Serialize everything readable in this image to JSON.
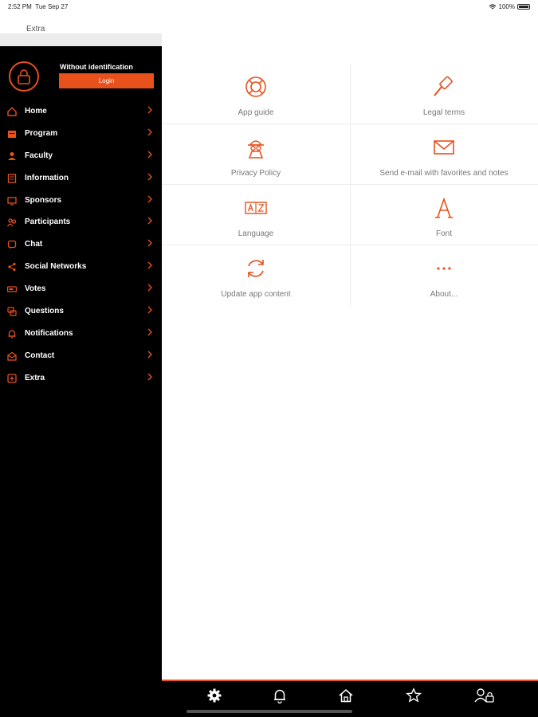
{
  "status_bar": {
    "time": "2:52 PM",
    "date": "Tue Sep 27",
    "battery": "100%"
  },
  "header": {
    "title": "Extra"
  },
  "profile": {
    "name": "Without identification",
    "login_label": "Login"
  },
  "menu": {
    "items": [
      {
        "label": "Home",
        "icon": "home-icon"
      },
      {
        "label": "Program",
        "icon": "calendar-icon"
      },
      {
        "label": "Faculty",
        "icon": "person-icon"
      },
      {
        "label": "Information",
        "icon": "info-icon"
      },
      {
        "label": "Sponsors",
        "icon": "sponsors-icon"
      },
      {
        "label": "Participants",
        "icon": "participants-icon"
      },
      {
        "label": "Chat",
        "icon": "chat-icon"
      },
      {
        "label": "Social Networks",
        "icon": "share-icon"
      },
      {
        "label": "Votes",
        "icon": "votes-icon"
      },
      {
        "label": "Questions",
        "icon": "questions-icon"
      },
      {
        "label": "Notifications",
        "icon": "bell-icon"
      },
      {
        "label": "Contact",
        "icon": "mail-icon"
      },
      {
        "label": "Extra",
        "icon": "plus-icon"
      }
    ]
  },
  "grid": {
    "items": [
      {
        "label": "App guide",
        "icon": "lifebuoy-icon"
      },
      {
        "label": "Legal terms",
        "icon": "gavel-icon"
      },
      {
        "label": "Privacy Policy",
        "icon": "privacy-icon"
      },
      {
        "label": "Send e-mail with favorites and notes",
        "icon": "envelope-icon"
      },
      {
        "label": "Language",
        "icon": "language-icon"
      },
      {
        "label": "Font",
        "icon": "font-icon"
      },
      {
        "label": "Update app content",
        "icon": "refresh-icon"
      },
      {
        "label": "About...",
        "icon": "ellipsis-icon"
      }
    ]
  },
  "bottom_bar": {
    "tabs": [
      "gear-icon",
      "bell-icon",
      "home-icon",
      "star-icon",
      "profile-lock-icon"
    ]
  },
  "colors": {
    "accent": "#e8501c",
    "sidebar_bg": "#000000",
    "text_muted": "#777777"
  }
}
